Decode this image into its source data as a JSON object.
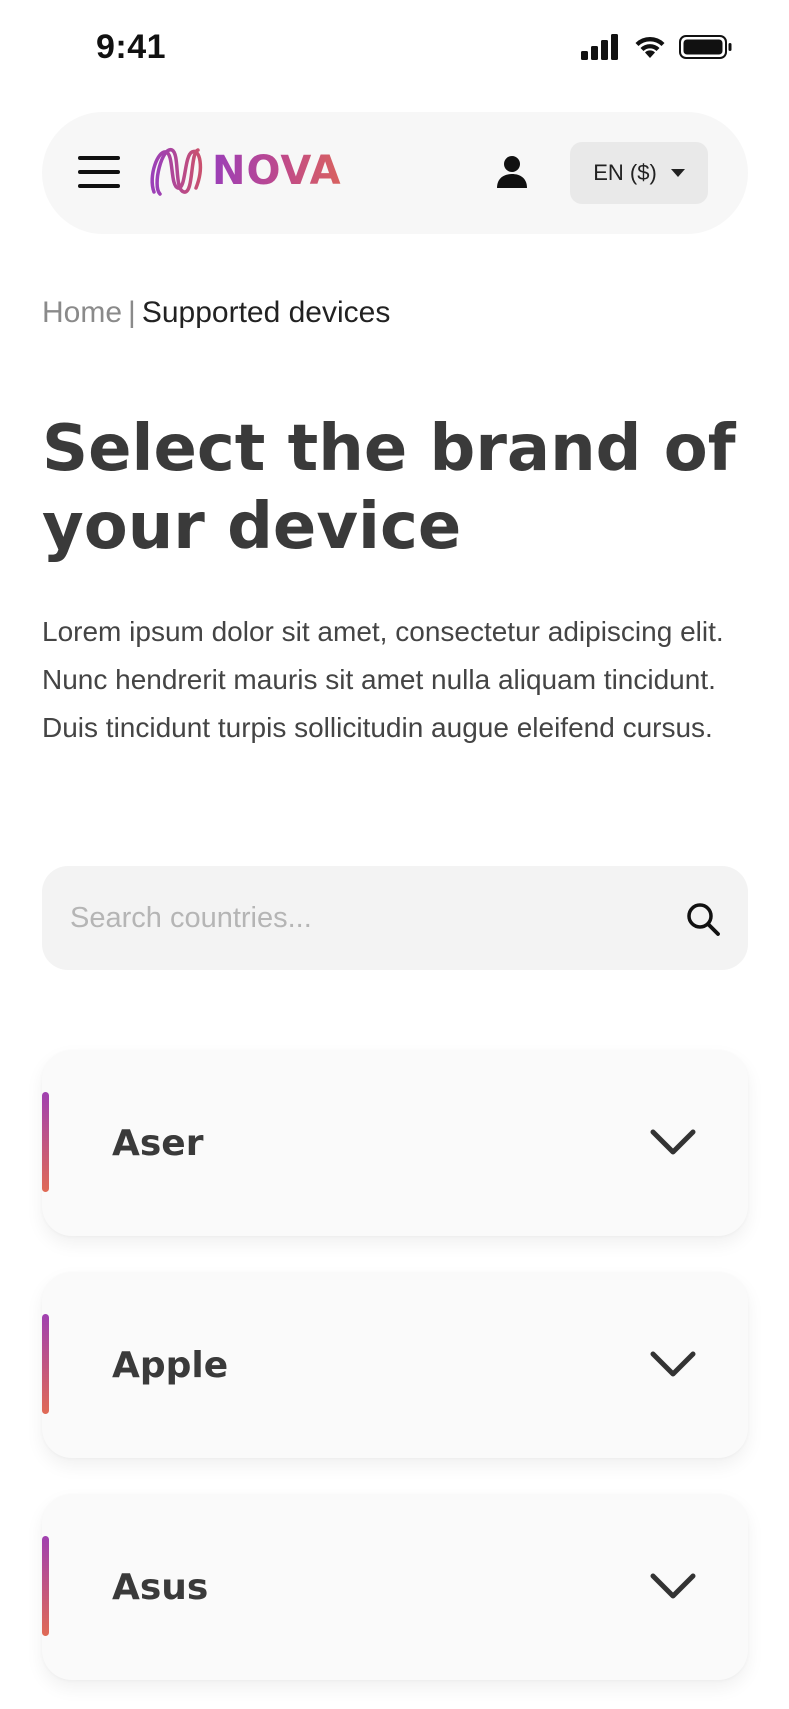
{
  "status_bar": {
    "time": "9:41",
    "icons": [
      "signal-icon",
      "wifi-icon",
      "battery-icon"
    ]
  },
  "header": {
    "menu_icon": "hamburger-menu-icon",
    "logo_text": "NOVA",
    "logo_colors": [
      "#9b3fb8",
      "#d9625e"
    ],
    "user_icon": "user-icon",
    "language_label": "EN ($)",
    "language_caret_icon": "caret-down-icon"
  },
  "breadcrumb": {
    "home": "Home",
    "separator": "|",
    "current": "Supported devices"
  },
  "main": {
    "title": "Select the brand of your device",
    "description": "Lorem ipsum dolor sit amet, consectetur adipiscing elit. Nunc hendrerit mauris sit amet nulla aliquam tincidunt. Duis tincidunt turpis sollicitudin augue eleifend cursus."
  },
  "search": {
    "placeholder": "Search countries...",
    "value": "",
    "icon": "search-icon"
  },
  "brands": [
    {
      "name": "Aser"
    },
    {
      "name": "Apple"
    },
    {
      "name": "Asus"
    }
  ],
  "colors": {
    "accent_start": "#a040b0",
    "accent_end": "#e06a55",
    "text_primary": "#3a3a3a",
    "surface": "#f7f7f7"
  }
}
